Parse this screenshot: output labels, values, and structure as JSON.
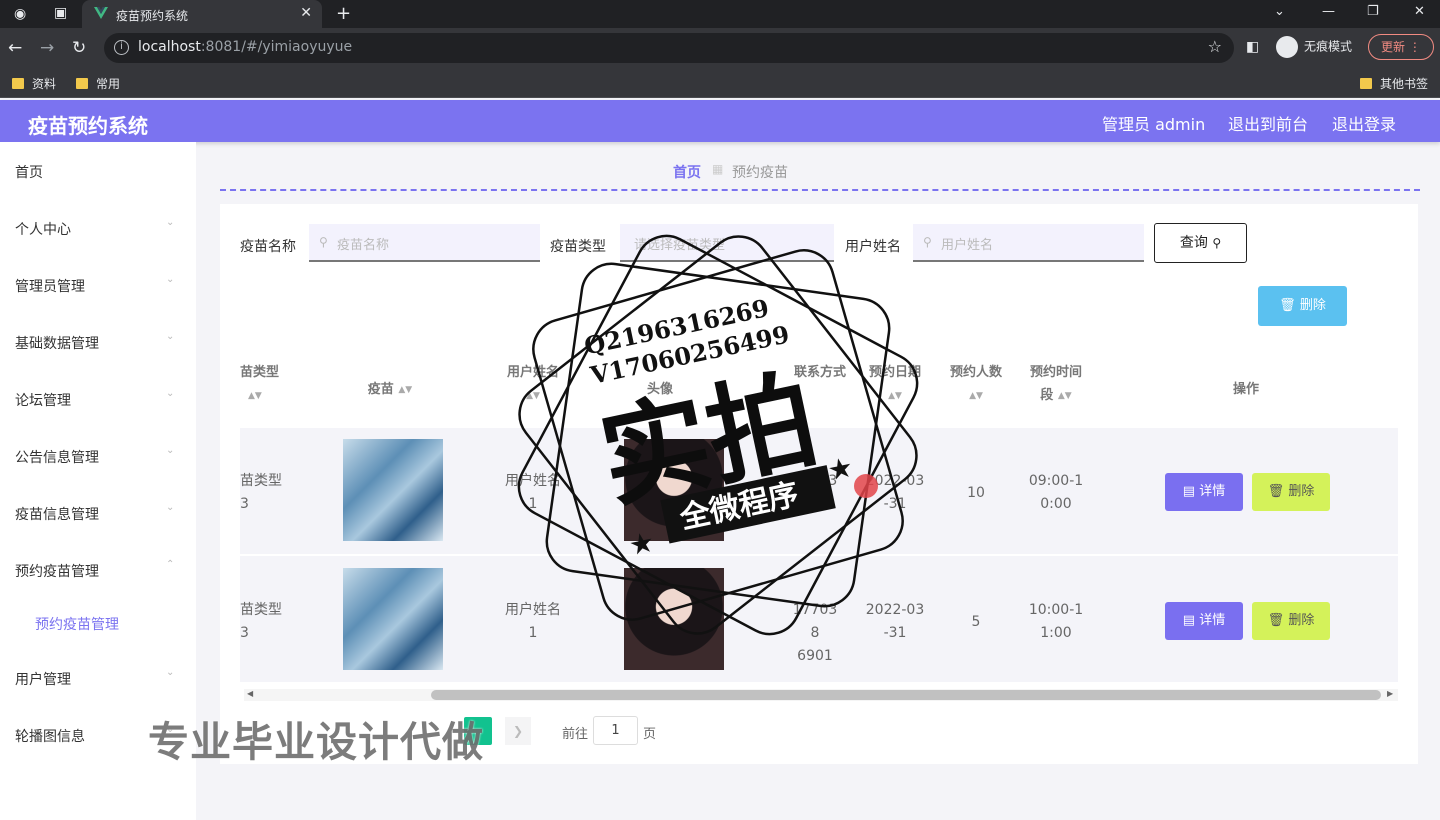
{
  "browser": {
    "tab_title": "疫苗预约系统",
    "url_host": "localhost",
    "url_rest": ":8081/#/yimiaoyuyue",
    "incognito_label": "无痕模式",
    "update_label": "更新",
    "bookmarks": [
      "资料",
      "常用"
    ],
    "other_bookmarks": "其他书签"
  },
  "header": {
    "app_title": "疫苗预约系统",
    "user_label": "管理员 admin",
    "to_front": "退出到前台",
    "logout": "退出登录"
  },
  "sidebar": {
    "items": [
      "首页",
      "个人中心",
      "管理员管理",
      "基础数据管理",
      "论坛管理",
      "公告信息管理",
      "疫苗信息管理",
      "预约疫苗管理",
      "预约疫苗管理",
      "用户管理",
      "轮播图信息"
    ]
  },
  "breadcrumb": {
    "home": "首页",
    "current": "预约疫苗"
  },
  "search": {
    "name_label": "疫苗名称",
    "name_placeholder": "疫苗名称",
    "type_label": "疫苗类型",
    "type_placeholder": "请选择疫苗类型",
    "user_label": "用户姓名",
    "user_placeholder": "用户姓名",
    "query_button": "查询",
    "delete_button": "删除"
  },
  "table": {
    "headers": [
      "苗类型",
      "疫苗",
      "用户姓名",
      "头像",
      "联系方式",
      "预约日期",
      "预约人数",
      "预约时间段",
      "操作"
    ],
    "rows": [
      {
        "type": "苗类型 3",
        "user": "用户姓名 1",
        "phone": "17703 8",
        "date": "2022-03 -31",
        "count": "10",
        "time": "09:00-1 0:00"
      },
      {
        "type": "苗类型 3",
        "user": "用户姓名 1",
        "phone": "17703 8 6901",
        "date": "2022-03 -31",
        "count": "5",
        "time": "10:00-1 1:00"
      }
    ],
    "detail_button": "详情",
    "delete_button": "删除"
  },
  "pagination": {
    "goto_label": "前往",
    "page_value": "1",
    "page_suffix": "页"
  },
  "watermark": {
    "banner": "专业毕业设计代做",
    "stamp_line1": "Q2196316269",
    "stamp_line2": "V17060256499",
    "stamp_main": "实拍",
    "stamp_ribbon": "全微程序"
  },
  "colors": {
    "accent": "#7b73f0",
    "detail": "#7a6ff0",
    "delete": "#d4f25a",
    "delete_all": "#5bc1f0",
    "page_active": "#12c28f"
  }
}
